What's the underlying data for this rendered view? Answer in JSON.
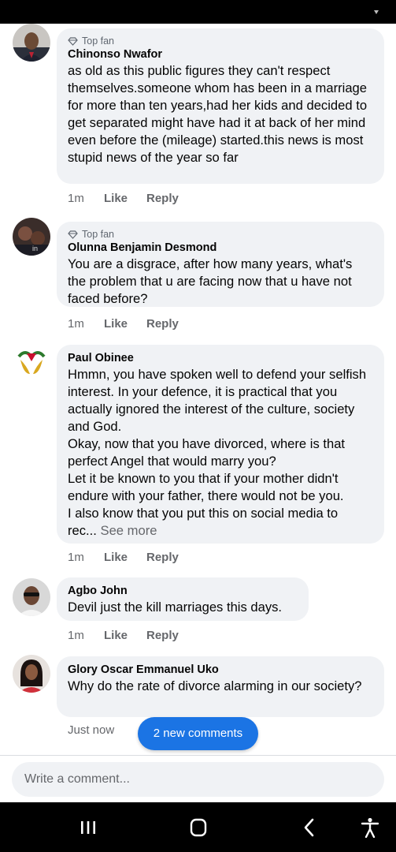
{
  "comments": [
    {
      "badge": "Top fan",
      "author": "Chinonso Nwafor",
      "text": "as old as this public figures they can't respect themselves.someone whom has been in a marriage for more than ten years,had her kids and decided to get separated might  have had it at back of her mind even before the (mileage) started.this news is most stupid news of the year so far",
      "time": "1m",
      "like": "Like",
      "reply": "Reply"
    },
    {
      "badge": "Top fan",
      "author": "Olunna Benjamin Desmond",
      "text": "You are a disgrace, after how many years, what's the problem that u are facing now that u have not faced before?",
      "time": "1m",
      "like": "Like",
      "reply": "Reply"
    },
    {
      "author": "Paul Obinee",
      "paragraphs": [
        "Hmmn, you have spoken well to defend your selfish interest. In your defence, it is practical that you actually ignored the interest of the culture, society and God.",
        "Okay, now that you have divorced, where is that perfect Angel that would marry you?",
        "Let it be known to you that if your mother didn't endure with your father, there would not be you.",
        "I also know that you put this on social media to"
      ],
      "truncated": "rec...",
      "see_more": "See more",
      "time": "1m",
      "like": "Like",
      "reply": "Reply"
    },
    {
      "author": "Agbo John",
      "text": "Devil just the kill marriages this days.",
      "time": "1m",
      "like": "Like",
      "reply": "Reply"
    },
    {
      "author": "Glory Oscar Emmanuel Uko",
      "text": "Why do the rate of divorce alarming in our society?",
      "time": "Just now"
    }
  ],
  "new_comments_pill": "2 new comments",
  "composer": {
    "placeholder": "Write a comment..."
  },
  "colors": {
    "accent": "#1b74e4",
    "bubble": "#f0f2f5",
    "secondary_text": "#65676b"
  },
  "nav": [
    "recent-apps-icon",
    "home-icon",
    "back-icon",
    "accessibility-icon"
  ]
}
